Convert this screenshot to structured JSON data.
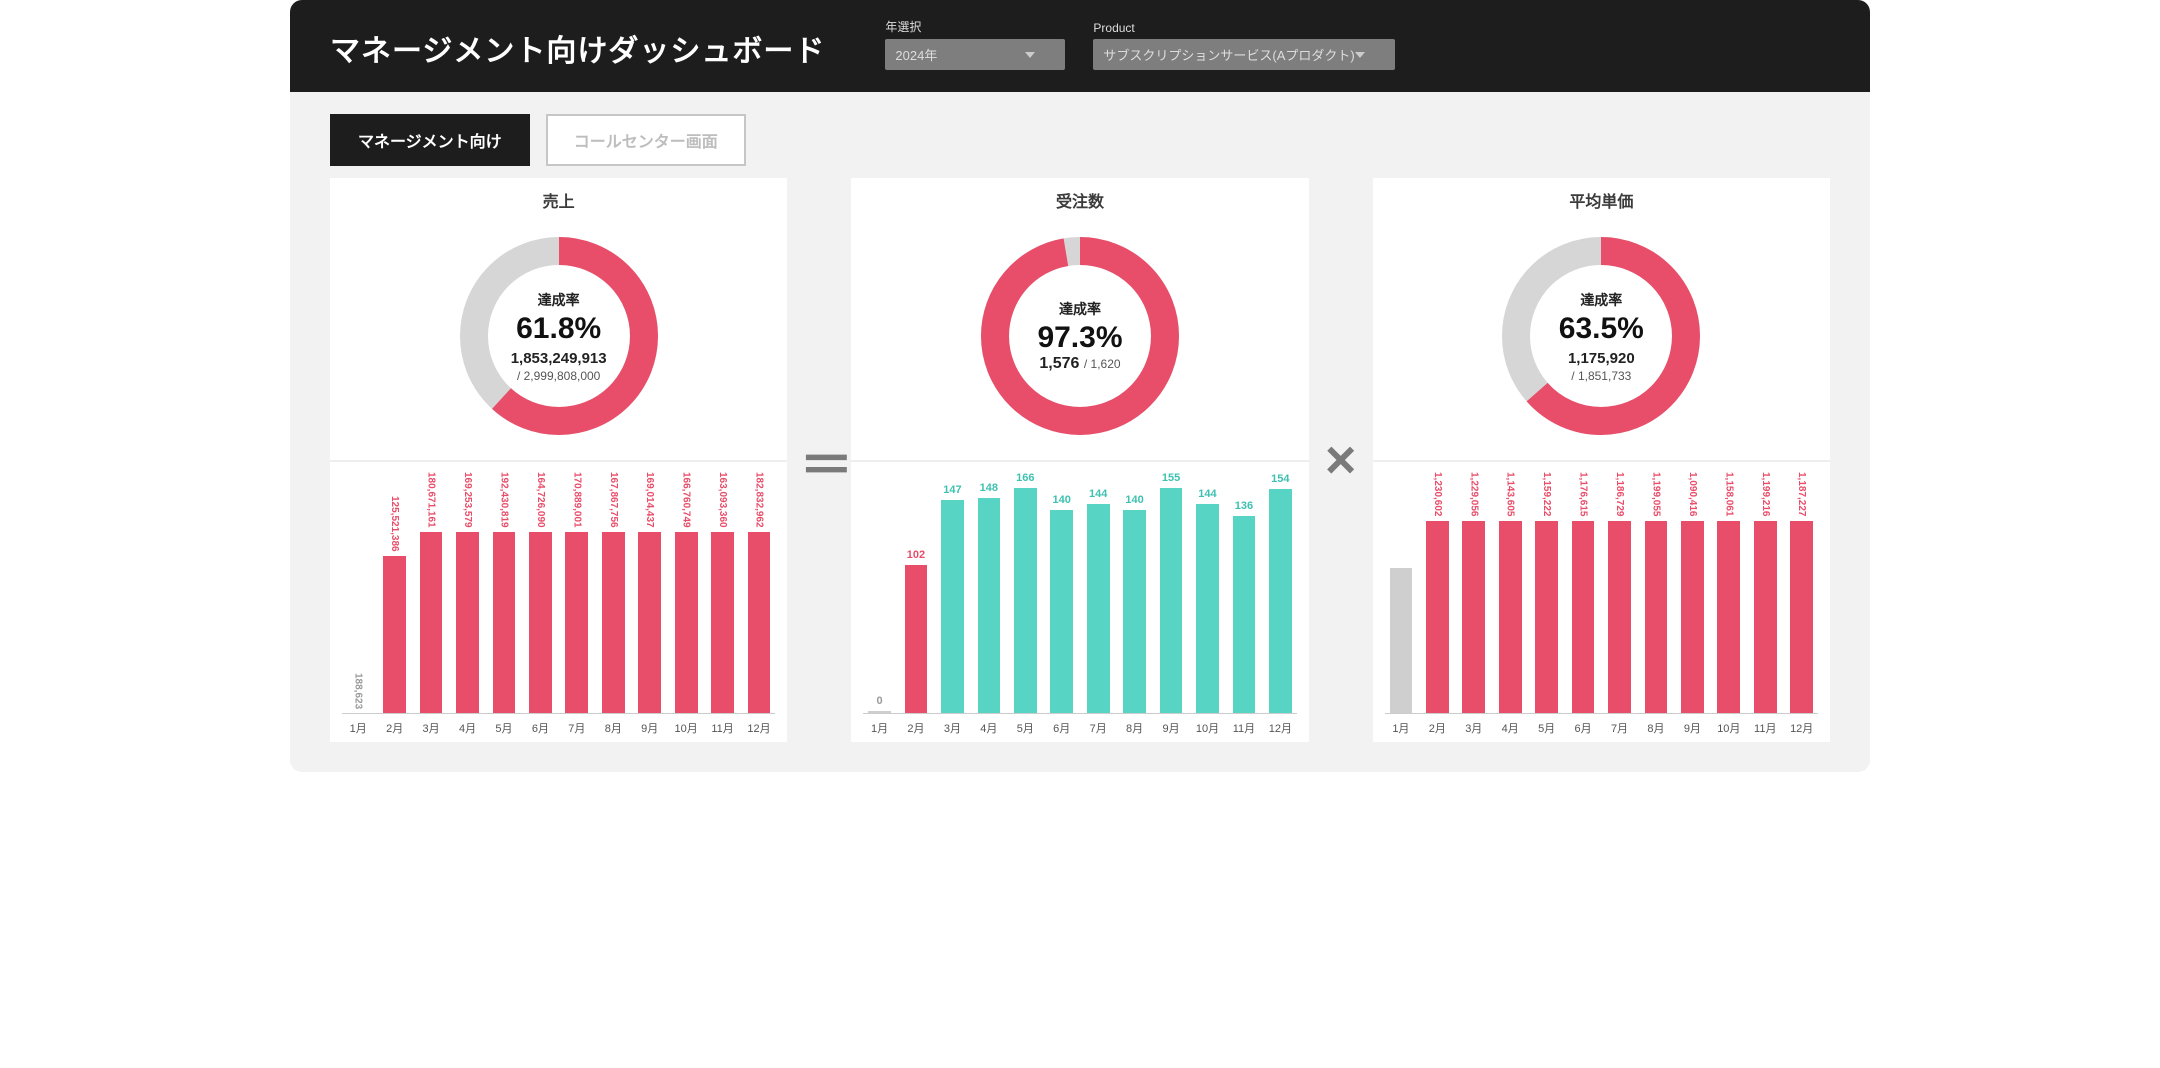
{
  "header": {
    "title": "マネージメント向けダッシュボード",
    "year_label": "年選択",
    "year_value": "2024年",
    "product_label": "Product",
    "product_value": "サブスクリプションサービス(Aプロダクト)"
  },
  "tabs": {
    "management": "マネージメント向け",
    "callcenter": "コールセンター画面"
  },
  "operators": {
    "equals": "＝",
    "times": "×"
  },
  "months": [
    "1月",
    "2月",
    "3月",
    "4月",
    "5月",
    "6月",
    "7月",
    "8月",
    "9月",
    "10月",
    "11月",
    "12月"
  ],
  "kpis": {
    "sales": {
      "title": "売上",
      "label": "達成率",
      "percent": "61.8%",
      "value": "1,853,249,913",
      "target": "/ 2,999,808,000"
    },
    "orders": {
      "title": "受注数",
      "label": "達成率",
      "percent": "97.3%",
      "value": "1,576",
      "target": "/ 1,620"
    },
    "price": {
      "title": "平均単価",
      "label": "達成率",
      "percent": "63.5%",
      "value": "1,175,920",
      "target": "/ 1,851,733"
    }
  },
  "chart_data": [
    {
      "id": "sales",
      "type": "donut",
      "title": "売上 達成率",
      "percent": 61.8,
      "value": 1853249913,
      "target": 2999808000
    },
    {
      "id": "orders",
      "type": "donut",
      "title": "受注数 達成率",
      "percent": 97.3,
      "value": 1576,
      "target": 1620
    },
    {
      "id": "price",
      "type": "donut",
      "title": "平均単価 達成率",
      "percent": 63.5,
      "value": 1175920,
      "target": 1851733
    },
    {
      "id": "sales_monthly",
      "type": "bar",
      "title": "売上 月次",
      "categories": [
        "1月",
        "2月",
        "3月",
        "4月",
        "5月",
        "6月",
        "7月",
        "8月",
        "9月",
        "10月",
        "11月",
        "12月"
      ],
      "series": [
        {
          "name": "売上",
          "color": "#e84e6a",
          "values": [
            188623,
            125521386,
            180671161,
            169253579,
            192430819,
            164726090,
            170889001,
            167867756,
            169014437,
            166760749,
            163093360,
            182832962
          ]
        }
      ],
      "grey_indices": [
        0
      ],
      "label_style": "vertical",
      "labels": [
        "188,623",
        "125,521,386",
        "180,671,161",
        "169,253,579",
        "192,430,819",
        "164,726,090",
        "170,889,001",
        "167,867,756",
        "169,014,437",
        "166,760,749",
        "163,093,360",
        "182,832,962"
      ]
    },
    {
      "id": "orders_monthly",
      "type": "bar",
      "title": "受注数 月次",
      "categories": [
        "1月",
        "2月",
        "3月",
        "4月",
        "5月",
        "6月",
        "7月",
        "8月",
        "9月",
        "10月",
        "11月",
        "12月"
      ],
      "series": [
        {
          "name": "受注数",
          "color": "#57d4c4",
          "values": [
            0,
            102,
            147,
            148,
            166,
            140,
            144,
            140,
            155,
            144,
            136,
            154
          ]
        }
      ],
      "alt_color_indices": [
        1
      ],
      "grey_indices": [
        0
      ],
      "label_style": "horizontal",
      "labels": [
        "0",
        "102",
        "147",
        "148",
        "166",
        "140",
        "144",
        "140",
        "155",
        "144",
        "136",
        "154"
      ]
    },
    {
      "id": "price_monthly",
      "type": "bar",
      "title": "平均単価 月次",
      "categories": [
        "1月",
        "2月",
        "3月",
        "4月",
        "5月",
        "6月",
        "7月",
        "8月",
        "9月",
        "10月",
        "11月",
        "12月"
      ],
      "series": [
        {
          "name": "平均単価",
          "color": "#e84e6a",
          "values": [
            null,
            1230602,
            1229056,
            1143605,
            1159222,
            1176615,
            1186729,
            1199055,
            1090416,
            1158061,
            1199216,
            1187227
          ]
        }
      ],
      "grey_indices": [
        0
      ],
      "label_style": "vertical",
      "labels": [
        "",
        "1,230,602",
        "1,229,056",
        "1,143,605",
        "1,159,222",
        "1,176,615",
        "1,186,729",
        "1,199,055",
        "1,090,416",
        "1,158,061",
        "1,199,216",
        "1,187,227"
      ]
    }
  ]
}
